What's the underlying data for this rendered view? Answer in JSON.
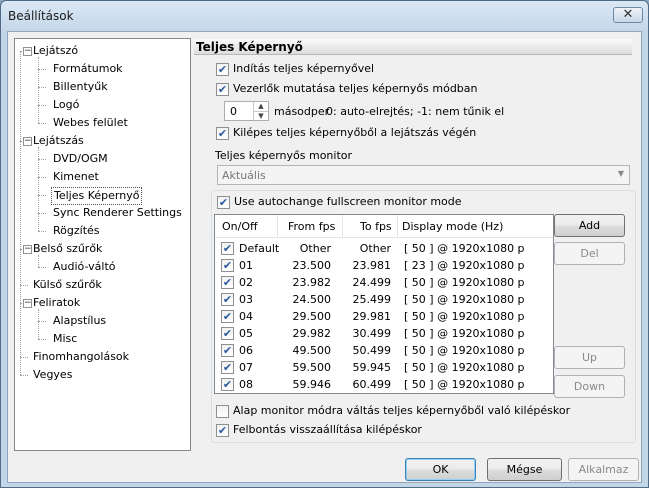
{
  "window": {
    "title": "Beállítások",
    "close_glyph": "✕"
  },
  "tree": {
    "items": [
      {
        "label": "Lejátszó",
        "level": 0,
        "expanded": true
      },
      {
        "label": "Formátumok",
        "level": 1
      },
      {
        "label": "Billentyűk",
        "level": 1
      },
      {
        "label": "Logó",
        "level": 1
      },
      {
        "label": "Webes felület",
        "level": 1
      },
      {
        "label": "Lejátszás",
        "level": 0,
        "expanded": true
      },
      {
        "label": "DVD/OGM",
        "level": 1
      },
      {
        "label": "Kimenet",
        "level": 1
      },
      {
        "label": "Teljes Képernyő",
        "level": 1,
        "selected": true
      },
      {
        "label": "Sync Renderer Settings",
        "level": 1
      },
      {
        "label": "Rögzítés",
        "level": 1
      },
      {
        "label": "Belső szűrők",
        "level": 0,
        "expanded": true
      },
      {
        "label": "Audió-váltó",
        "level": 1
      },
      {
        "label": "Külső szűrők",
        "level": 0
      },
      {
        "label": "Feliratok",
        "level": 0,
        "expanded": true
      },
      {
        "label": "Alapstílus",
        "level": 1
      },
      {
        "label": "Misc",
        "level": 1
      },
      {
        "label": "Finomhangolások",
        "level": 0
      },
      {
        "label": "Vegyes",
        "level": 0
      }
    ]
  },
  "section": {
    "title": "Teljes Képernyő",
    "launch_fullscreen": {
      "label": "Indítás teljes képernyővel",
      "checked": true
    },
    "show_controls": {
      "label": "Vezerlők mutatása teljes képernyős módban",
      "checked": true
    },
    "hide_delay": {
      "value": "0",
      "unit": "másodper",
      "hint": "0: auto-elrejtés; -1: nem tűnik el"
    },
    "exit_at_end": {
      "label": "Kilépes teljes képernyőből a lejátszás végén",
      "checked": true
    },
    "monitor_label": "Teljes képernyős monitor",
    "monitor_value": "Aktuális",
    "autochange": {
      "label": "Use autochange fullscreen monitor mode",
      "checked": true
    },
    "columns": [
      "On/Off",
      "From fps",
      "To fps",
      "Display mode (Hz)"
    ],
    "rows": [
      {
        "name": "Default",
        "from": "Other",
        "to": "Other",
        "mode": "[ 50 ]  @ 1920x1080 p",
        "checked": true
      },
      {
        "name": "01",
        "from": "23.500",
        "to": "23.981",
        "mode": "[ 23 ]  @ 1920x1080 p",
        "checked": true
      },
      {
        "name": "02",
        "from": "23.982",
        "to": "24.499",
        "mode": "[ 50 ]  @ 1920x1080 p",
        "checked": true
      },
      {
        "name": "03",
        "from": "24.500",
        "to": "25.499",
        "mode": "[ 50 ]  @ 1920x1080 p",
        "checked": true
      },
      {
        "name": "04",
        "from": "29.500",
        "to": "29.981",
        "mode": "[ 50 ]  @ 1920x1080 p",
        "checked": true
      },
      {
        "name": "05",
        "from": "29.982",
        "to": "30.499",
        "mode": "[ 50 ]  @ 1920x1080 p",
        "checked": true
      },
      {
        "name": "06",
        "from": "49.500",
        "to": "50.499",
        "mode": "[ 50 ]  @ 1920x1080 p",
        "checked": true
      },
      {
        "name": "07",
        "from": "59.500",
        "to": "59.945",
        "mode": "[ 50 ]  @ 1920x1080 p",
        "checked": true
      },
      {
        "name": "08",
        "from": "59.946",
        "to": "60.499",
        "mode": "[ 50 ]  @ 1920x1080 p",
        "checked": true
      }
    ],
    "buttons": {
      "add": "Add",
      "del": "Del",
      "up": "Up",
      "down": "Down"
    },
    "switch_on_exit": {
      "label": "Alap monitor módra váltás teljes képernyőből való kilépéskor",
      "checked": false
    },
    "restore_res": {
      "label": "Felbontás visszaállítása kilépéskor",
      "checked": true
    }
  },
  "footer": {
    "ok": "OK",
    "cancel": "Mégse",
    "apply": "Alkalmaz"
  },
  "check_glyph": "✔"
}
